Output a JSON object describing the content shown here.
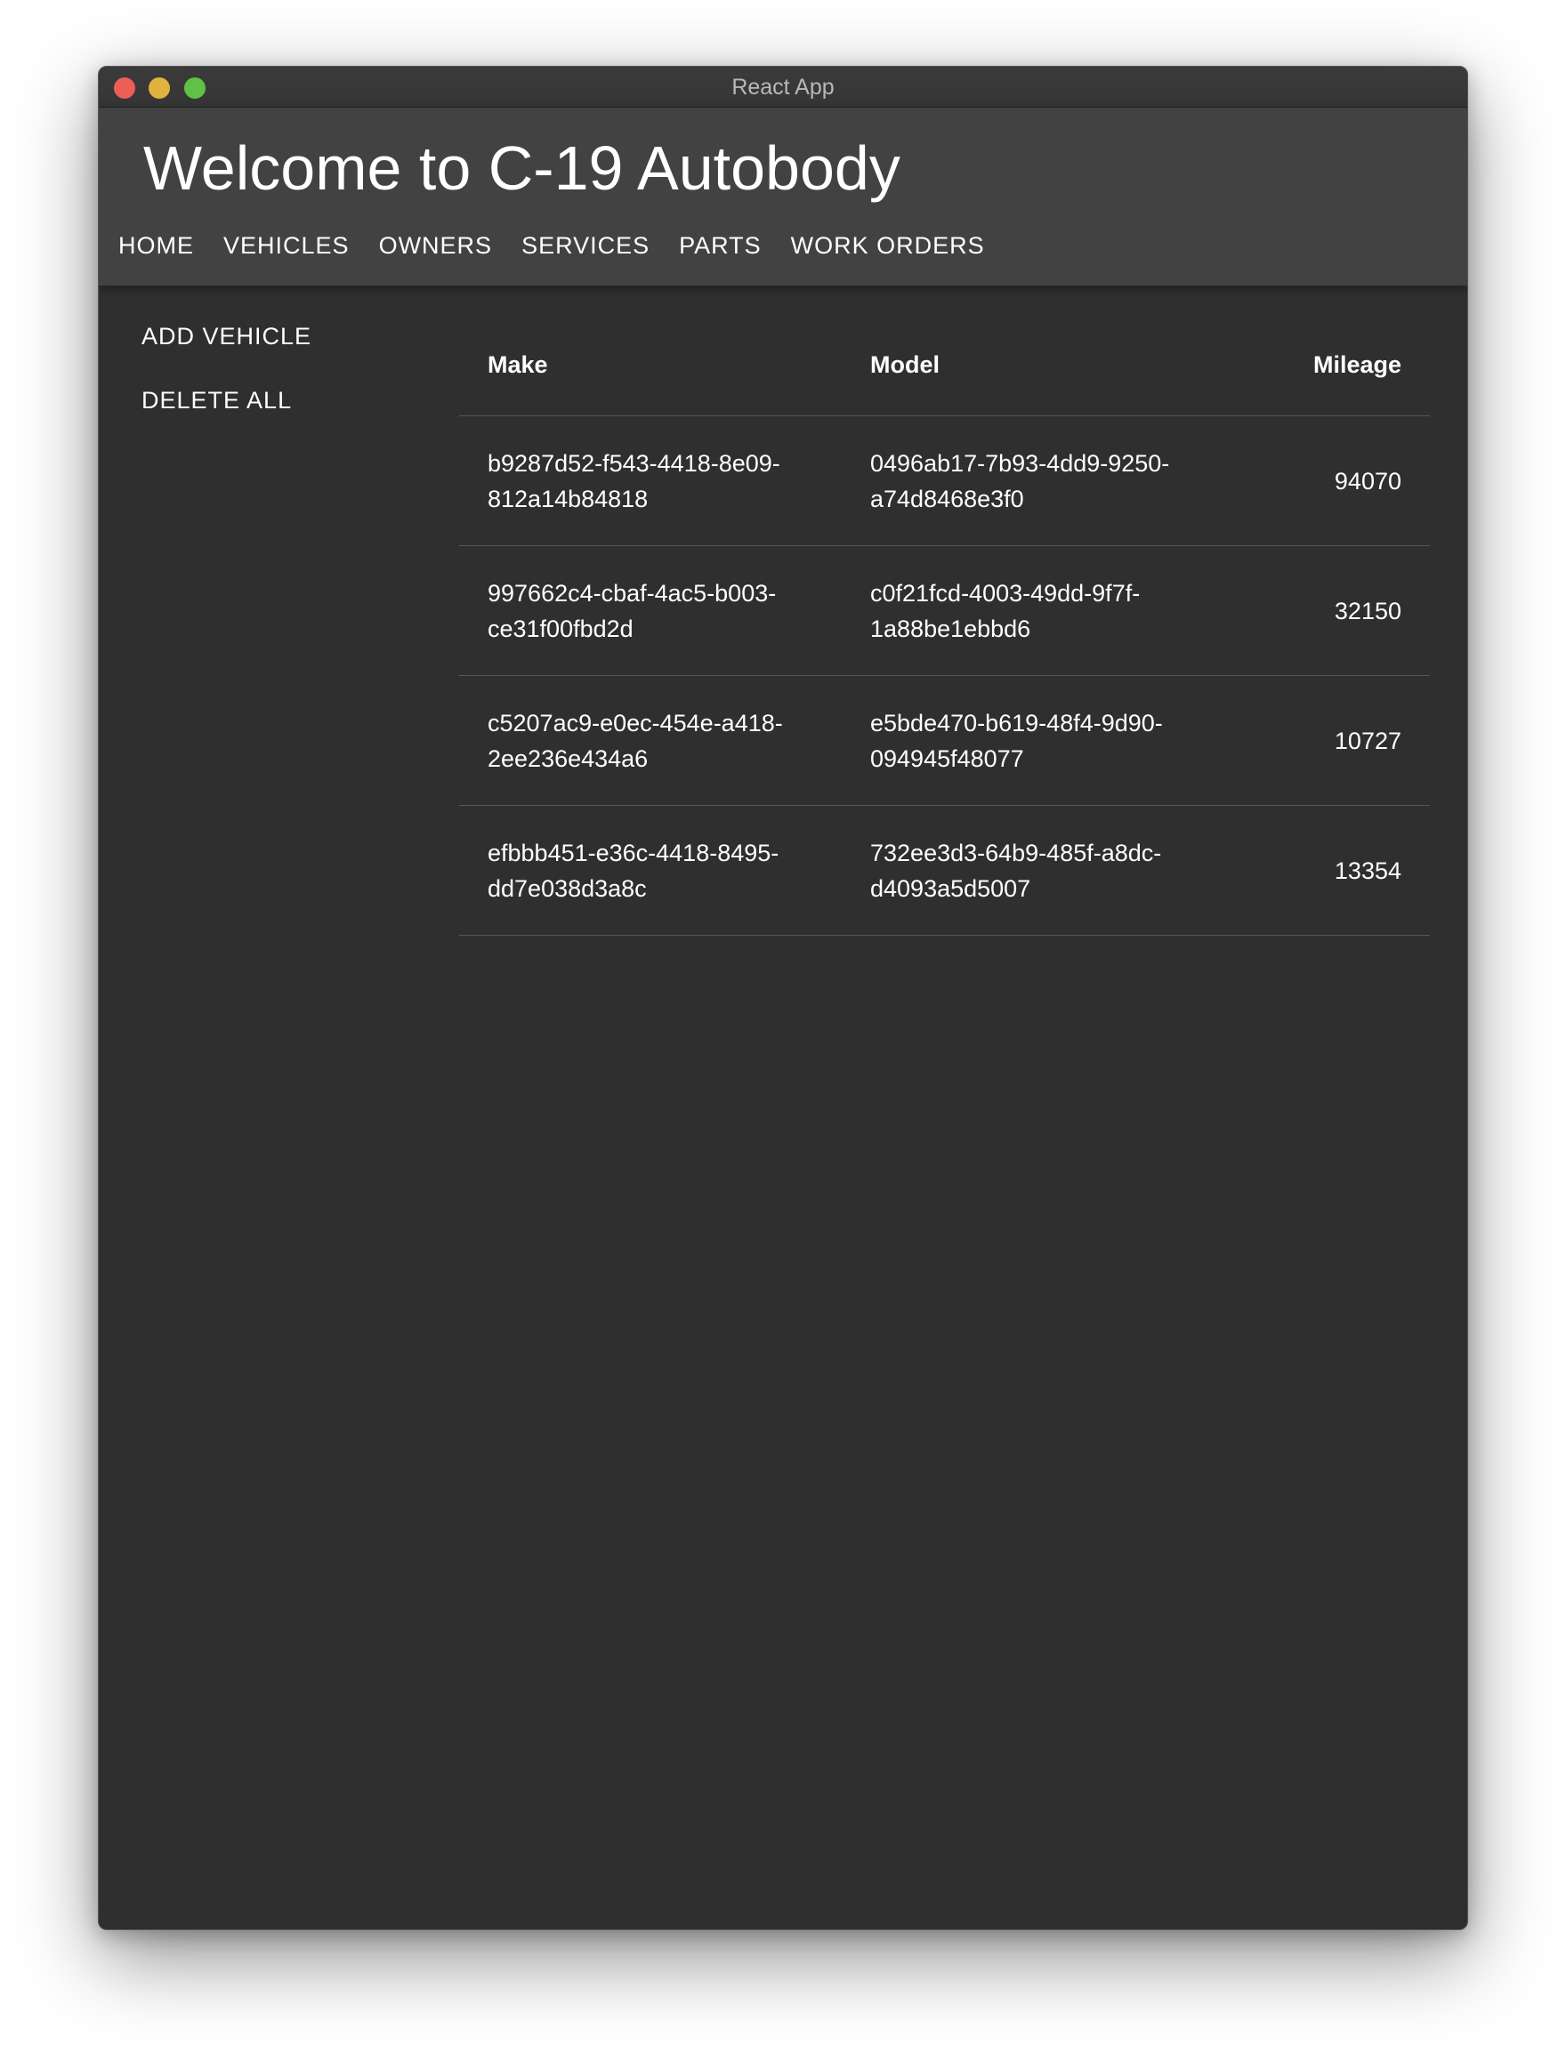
{
  "window": {
    "title": "React App"
  },
  "app": {
    "title": "Welcome to C-19 Autobody",
    "nav": [
      "HOME",
      "VEHICLES",
      "OWNERS",
      "SERVICES",
      "PARTS",
      "WORK ORDERS"
    ]
  },
  "sidebar": {
    "add_label": "ADD VEHICLE",
    "delete_label": "DELETE ALL"
  },
  "table": {
    "headers": {
      "make": "Make",
      "model": "Model",
      "mileage": "Mileage"
    },
    "rows": [
      {
        "make_line1": "b9287d52-f543-4418-8e09-",
        "make_line2": "812a14b84818",
        "model_line1": "0496ab17-7b93-4dd9-9250-",
        "model_line2": "a74d8468e3f0",
        "mileage": "94070"
      },
      {
        "make_line1": "997662c4-cbaf-4ac5-b003-",
        "make_line2": "ce31f00fbd2d",
        "model_line1": "c0f21fcd-4003-49dd-9f7f-",
        "model_line2": "1a88be1ebbd6",
        "mileage": "32150"
      },
      {
        "make_line1": "c5207ac9-e0ec-454e-a418-",
        "make_line2": "2ee236e434a6",
        "model_line1": "e5bde470-b619-48f4-9d90-",
        "model_line2": "094945f48077",
        "mileage": "10727"
      },
      {
        "make_line1": "efbbb451-e36c-4418-8495-",
        "make_line2": "dd7e038d3a8c",
        "model_line1": "732ee3d3-64b9-485f-a8dc-",
        "model_line2": "d4093a5d5007",
        "mileage": "13354"
      }
    ]
  },
  "colors": {
    "window_bg": "#2f2f2f",
    "appbar_bg": "#424242",
    "text": "#ffffff",
    "close": "#ec5f57",
    "minimize": "#e1b33e",
    "maximize": "#5fc245"
  }
}
